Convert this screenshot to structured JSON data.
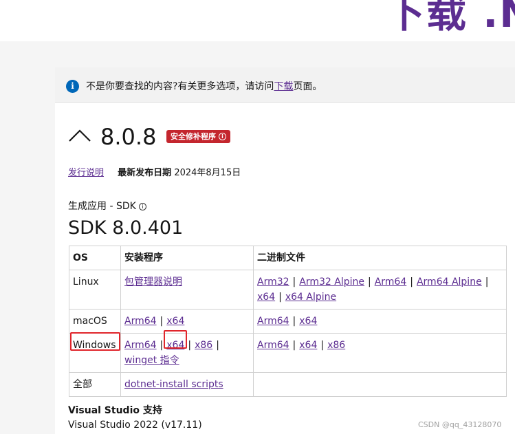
{
  "hero": {
    "title": "下载 .N"
  },
  "notice": {
    "text_before": "不是你要查找的内容?有关更多选项，请访问",
    "link": "下载",
    "text_after": "页面。"
  },
  "release": {
    "version": "8.0.8",
    "badge": "安全修补程序",
    "notes_link": "发行说明",
    "date_label": "最新发布日期",
    "date_value": "2024年8月15日"
  },
  "sdk": {
    "subtitle": "生成应用 - SDK",
    "version": "SDK 8.0.401"
  },
  "table": {
    "headers": [
      "OS",
      "安装程序",
      "二进制文件"
    ],
    "rows": [
      {
        "os": "Linux",
        "installer": [
          "包管理器说明"
        ],
        "binaries": [
          "Arm32",
          "Arm32 Alpine",
          "Arm64",
          "Arm64 Alpine",
          "x64",
          "x64 Alpine"
        ]
      },
      {
        "os": "macOS",
        "installer": [
          "Arm64",
          "x64"
        ],
        "binaries": [
          "Arm64",
          "x64"
        ]
      },
      {
        "os": "Windows",
        "installer": [
          "Arm64",
          "x64",
          "x86",
          "winget 指令"
        ],
        "binaries": [
          "Arm64",
          "x64",
          "x86"
        ]
      },
      {
        "os": "全部",
        "installer": [
          "dotnet-install scripts"
        ],
        "binaries": []
      }
    ]
  },
  "visual_studio": {
    "title": "Visual Studio 支持",
    "version": "Visual Studio 2022 (v17.11)"
  },
  "watermark": "CSDN @qq_43128070",
  "colors": {
    "link": "#5c2d91",
    "badge": "#c4262e",
    "info": "#0067b8",
    "highlight": "#e0252b"
  }
}
